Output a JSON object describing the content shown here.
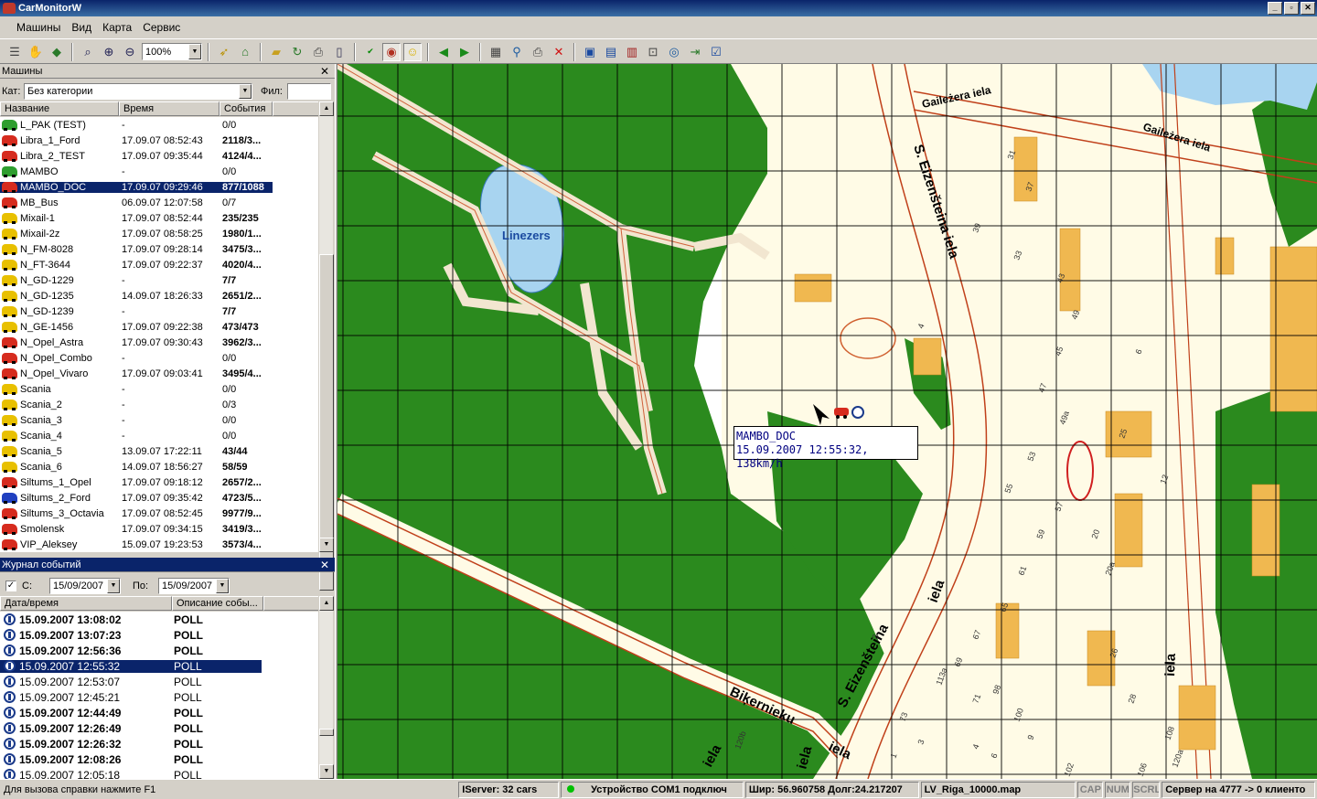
{
  "window": {
    "title": "CarMonitorW",
    "buttons": [
      "_",
      "▫",
      "✕"
    ]
  },
  "menu": [
    "Машины",
    "Вид",
    "Карта",
    "Сервис"
  ],
  "toolbar": {
    "zoom": "100%"
  },
  "cars_panel": {
    "title": "Машины",
    "category_label": "Кат:",
    "category_value": "Без категории",
    "filter_label": "Фил:",
    "filter_value": "",
    "columns": [
      "Название",
      "Время",
      "События"
    ],
    "rows": [
      {
        "name": "L_PAK (TEST)",
        "time": "-",
        "events": "0/0",
        "color": "green",
        "bold": false
      },
      {
        "name": "Libra_1_Ford",
        "time": "17.09.07 08:52:43",
        "events": "2118/3...",
        "color": "red",
        "bold": true
      },
      {
        "name": "Libra_2_TEST",
        "time": "17.09.07 09:35:44",
        "events": "4124/4...",
        "color": "red",
        "bold": true
      },
      {
        "name": "MAMBO",
        "time": "-",
        "events": "0/0",
        "color": "green",
        "bold": false
      },
      {
        "name": "MAMBO_DOC",
        "time": "17.09.07 09:29:46",
        "events": "877/1088",
        "color": "red",
        "bold": true,
        "selected": true
      },
      {
        "name": "MB_Bus",
        "time": "06.09.07 12:07:58",
        "events": "0/7",
        "color": "red",
        "bold": false
      },
      {
        "name": "Mixail-1",
        "time": "17.09.07 08:52:44",
        "events": "235/235",
        "color": "yellow",
        "bold": true
      },
      {
        "name": "Mixail-2z",
        "time": "17.09.07 08:58:25",
        "events": "1980/1...",
        "color": "yellow",
        "bold": true
      },
      {
        "name": "N_FM-8028",
        "time": "17.09.07 09:28:14",
        "events": "3475/3...",
        "color": "yellow",
        "bold": true
      },
      {
        "name": "N_FT-3644",
        "time": "17.09.07 09:22:37",
        "events": "4020/4...",
        "color": "yellow",
        "bold": true
      },
      {
        "name": "N_GD-1229",
        "time": "-",
        "events": "7/7",
        "color": "yellow",
        "bold": true
      },
      {
        "name": "N_GD-1235",
        "time": "14.09.07 18:26:33",
        "events": "2651/2...",
        "color": "yellow",
        "bold": true
      },
      {
        "name": "N_GD-1239",
        "time": "-",
        "events": "7/7",
        "color": "yellow",
        "bold": true
      },
      {
        "name": "N_GE-1456",
        "time": "17.09.07 09:22:38",
        "events": "473/473",
        "color": "yellow",
        "bold": true
      },
      {
        "name": "N_Opel_Astra",
        "time": "17.09.07 09:30:43",
        "events": "3962/3...",
        "color": "red",
        "bold": true
      },
      {
        "name": "N_Opel_Combo",
        "time": "-",
        "events": "0/0",
        "color": "red",
        "bold": false
      },
      {
        "name": "N_Opel_Vivaro",
        "time": "17.09.07 09:03:41",
        "events": "3495/4...",
        "color": "red",
        "bold": true
      },
      {
        "name": "Scania",
        "time": "-",
        "events": "0/0",
        "color": "yellow",
        "bold": false
      },
      {
        "name": "Scania_2",
        "time": "-",
        "events": "0/3",
        "color": "yellow",
        "bold": false
      },
      {
        "name": "Scania_3",
        "time": "-",
        "events": "0/0",
        "color": "yellow",
        "bold": false
      },
      {
        "name": "Scania_4",
        "time": "-",
        "events": "0/0",
        "color": "yellow",
        "bold": false
      },
      {
        "name": "Scania_5",
        "time": "13.09.07 17:22:11",
        "events": "43/44",
        "color": "yellow",
        "bold": true
      },
      {
        "name": "Scania_6",
        "time": "14.09.07 18:56:27",
        "events": "58/59",
        "color": "yellow",
        "bold": true
      },
      {
        "name": "Siltums_1_Opel",
        "time": "17.09.07 09:18:12",
        "events": "2657/2...",
        "color": "red",
        "bold": true
      },
      {
        "name": "Siltums_2_Ford",
        "time": "17.09.07 09:35:42",
        "events": "4723/5...",
        "color": "blue",
        "bold": true
      },
      {
        "name": "Siltums_3_Octavia",
        "time": "17.09.07 08:52:45",
        "events": "9977/9...",
        "color": "red",
        "bold": true
      },
      {
        "name": "Smolensk",
        "time": "17.09.07 09:34:15",
        "events": "3419/3...",
        "color": "red",
        "bold": true
      },
      {
        "name": "VIP_Aleksey",
        "time": "15.09.07 19:23:53",
        "events": "3573/4...",
        "color": "red",
        "bold": true
      }
    ]
  },
  "events_panel": {
    "title": "Журнал событий",
    "from_label": "С:",
    "from_value": "15/09/2007",
    "to_label": "По:",
    "to_value": "15/09/2007",
    "columns": [
      "Дата/время",
      "Описание собы..."
    ],
    "rows": [
      {
        "dt": "15.09.2007 13:08:02",
        "desc": "POLL",
        "bold": true
      },
      {
        "dt": "15.09.2007 13:07:23",
        "desc": "POLL",
        "bold": true
      },
      {
        "dt": "15.09.2007 12:56:36",
        "desc": "POLL",
        "bold": true
      },
      {
        "dt": "15.09.2007 12:55:32",
        "desc": "POLL",
        "bold": false,
        "selected": true
      },
      {
        "dt": "15.09.2007 12:53:07",
        "desc": "POLL",
        "bold": false
      },
      {
        "dt": "15.09.2007 12:45:21",
        "desc": "POLL",
        "bold": false
      },
      {
        "dt": "15.09.2007 12:44:49",
        "desc": "POLL",
        "bold": true
      },
      {
        "dt": "15.09.2007 12:26:49",
        "desc": "POLL",
        "bold": true
      },
      {
        "dt": "15.09.2007 12:26:32",
        "desc": "POLL",
        "bold": true
      },
      {
        "dt": "15.09.2007 12:08:26",
        "desc": "POLL",
        "bold": true
      },
      {
        "dt": "15.09.2007 12:05:18",
        "desc": "POLL",
        "bold": false
      }
    ]
  },
  "map": {
    "tooltip_line1": "MAMBO_DOC",
    "tooltip_line2": "15.09.2007 12:55:32, 138km/h",
    "labels": {
      "lake": "Linezers",
      "street1": "Gaileżera iela",
      "street1b": "Gaileżera iela",
      "street2": "S. Eizenšteina iela",
      "street3": "S. Eizenšteina",
      "street3b": "iela",
      "street4": "Biķernieku",
      "street4b": "iela",
      "street4c": "iela",
      "street5": "iela",
      "street6": "iela"
    },
    "house_numbers": [
      "31",
      "37",
      "39",
      "33",
      "43",
      "49",
      "45",
      "47",
      "49a",
      "53",
      "55",
      "57",
      "59",
      "61",
      "65",
      "67",
      "69",
      "2",
      "4",
      "6",
      "25",
      "12",
      "20a",
      "20",
      "26",
      "28",
      "98",
      "100",
      "102",
      "106",
      "108",
      "120a",
      "120b",
      "113a",
      "71",
      "73",
      "1",
      "3",
      "4",
      "6",
      "9"
    ]
  },
  "status": {
    "help": "Для вызова справки нажмите F1",
    "server": "IServer: 32 cars",
    "device": "Устройство COM1 подключ",
    "coords": "Шир: 56.960758 Долг:24.217207",
    "mapfile": "LV_Riga_10000.map",
    "cap": "CAP",
    "num": "NUM",
    "scrl": "SCRL",
    "conn": "Сервер на 4777 -> 0 клиенто"
  }
}
